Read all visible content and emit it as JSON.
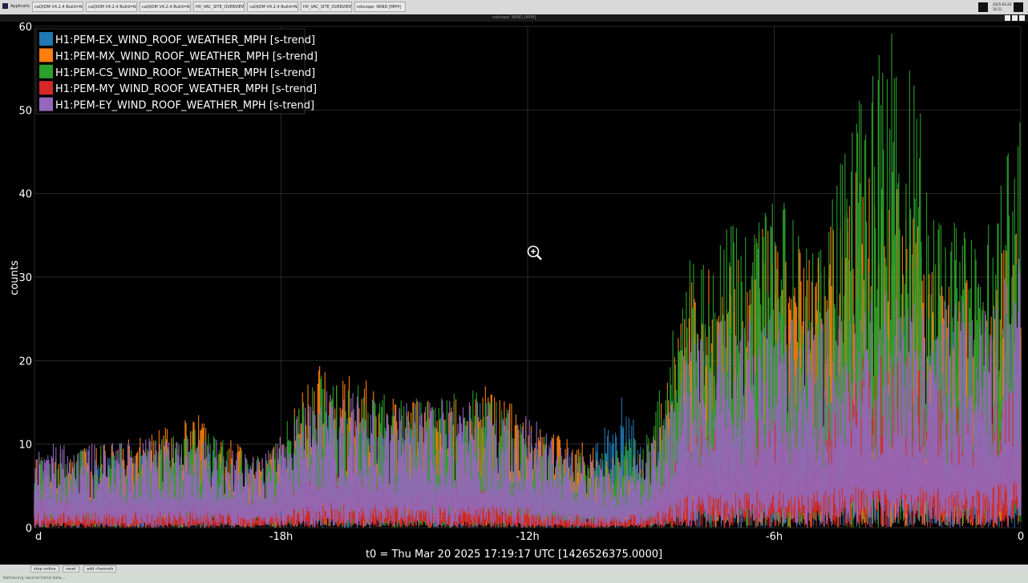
{
  "taskbar": {
    "applications_label": "Applications",
    "tasks": [
      "caQtDM V4.2.4 Build=No...",
      "caQtDM V4.2.4 Build=No...",
      "caQtDM V4.2.4 Build=No...",
      "H0_VAC_SITE_OVERVIEW...",
      "caQtDM V4.2.4 Build=No...",
      "H0_VAC_SITE_OVERVIEW...",
      "ndscope: WIND [MPH]"
    ],
    "clock_date": "2025-03-20",
    "clock_time": "10:21"
  },
  "window": {
    "title": "ndscope: WIND [MPH]"
  },
  "chart_data": {
    "type": "line",
    "ylabel": "counts",
    "xlabel": "t0 = Thu Mar 20 2025 17:19:17 UTC [1426526375.0000]",
    "ylim": [
      0,
      60
    ],
    "yticks": [
      0,
      10,
      20,
      30,
      40,
      50,
      60
    ],
    "xlim_hours": [
      -24,
      0
    ],
    "xticks": [
      {
        "value": -24,
        "label": "d"
      },
      {
        "value": -18,
        "label": "-18h"
      },
      {
        "value": -12,
        "label": "-12h"
      },
      {
        "value": -6,
        "label": "-6h"
      },
      {
        "value": 0,
        "label": "0"
      }
    ],
    "grid": true,
    "legend_position": "top-left",
    "zoom_cursor": true,
    "series": [
      {
        "name": "H1:PEM-EX_WIND_ROOF_WEATHER_MPH [s-trend]",
        "color": "#1f77b4",
        "profile_hours": [
          -24,
          -22,
          -20,
          -18.5,
          -17,
          -15,
          -13,
          -12,
          -10.5,
          -9.8,
          -9,
          -8,
          -7,
          -6,
          -5,
          -4,
          -3,
          -2,
          -1,
          0
        ],
        "profile_values": [
          4,
          5,
          6,
          4,
          8,
          7,
          9,
          6,
          5,
          10,
          5,
          14,
          12,
          16,
          15,
          18,
          16,
          15,
          14,
          15
        ]
      },
      {
        "name": "H1:PEM-MX_WIND_ROOF_WEATHER_MPH [s-trend]",
        "color": "#ff7f0e",
        "profile_hours": [
          -24,
          -22,
          -20,
          -18.5,
          -17,
          -15,
          -13,
          -12,
          -10.5,
          -9.8,
          -9,
          -8,
          -7,
          -6,
          -5,
          -4,
          -3,
          -2,
          -1,
          0
        ],
        "profile_values": [
          5,
          6,
          8,
          5,
          12,
          9,
          10,
          8,
          6,
          5,
          6,
          18,
          20,
          22,
          19,
          26,
          24,
          20,
          18,
          22
        ]
      },
      {
        "name": "H1:PEM-CS_WIND_ROOF_WEATHER_MPH [s-trend]",
        "color": "#2ca02c",
        "profile_hours": [
          -24,
          -22,
          -20,
          -18.5,
          -17,
          -15,
          -13,
          -12,
          -10.5,
          -9.8,
          -9,
          -8,
          -7,
          -6,
          -5,
          -4,
          -3,
          -2,
          -1,
          0
        ],
        "profile_values": [
          5,
          6,
          7,
          5,
          11,
          9,
          10,
          7,
          5,
          6,
          7,
          20,
          22,
          24,
          20,
          30,
          36,
          24,
          20,
          30
        ]
      },
      {
        "name": "H1:PEM-MY_WIND_ROOF_WEATHER_MPH [s-trend]",
        "color": "#d62728",
        "profile_hours": [
          -24,
          -22,
          -20,
          -18.5,
          -17,
          -15,
          -13,
          -12,
          -10.5,
          -9.8,
          -9,
          -8,
          -7,
          -6,
          -5,
          -4,
          -3,
          -2,
          -1,
          0
        ],
        "profile_values": [
          2,
          2,
          2,
          2,
          4,
          3,
          3,
          2,
          1,
          1,
          2,
          7,
          8,
          8,
          7,
          12,
          13,
          10,
          8,
          11
        ]
      },
      {
        "name": "H1:PEM-EY_WIND_ROOF_WEATHER_MPH [s-trend]",
        "color": "#9467bd",
        "profile_hours": [
          -24,
          -22,
          -20,
          -18.5,
          -17,
          -15,
          -13,
          -12,
          -10.5,
          -9.8,
          -9,
          -8,
          -7,
          -6,
          -5,
          -4,
          -3,
          -2,
          -1,
          0
        ],
        "profile_values": [
          6,
          6,
          7,
          5,
          10,
          9,
          9,
          8,
          5,
          5,
          6,
          14,
          15,
          16,
          15,
          17,
          17,
          16,
          16,
          20
        ]
      }
    ]
  },
  "bottom_bar": {
    "buttons": [
      "stop online",
      "reset",
      "add channels"
    ],
    "status": "Retrieving second trend data..."
  }
}
